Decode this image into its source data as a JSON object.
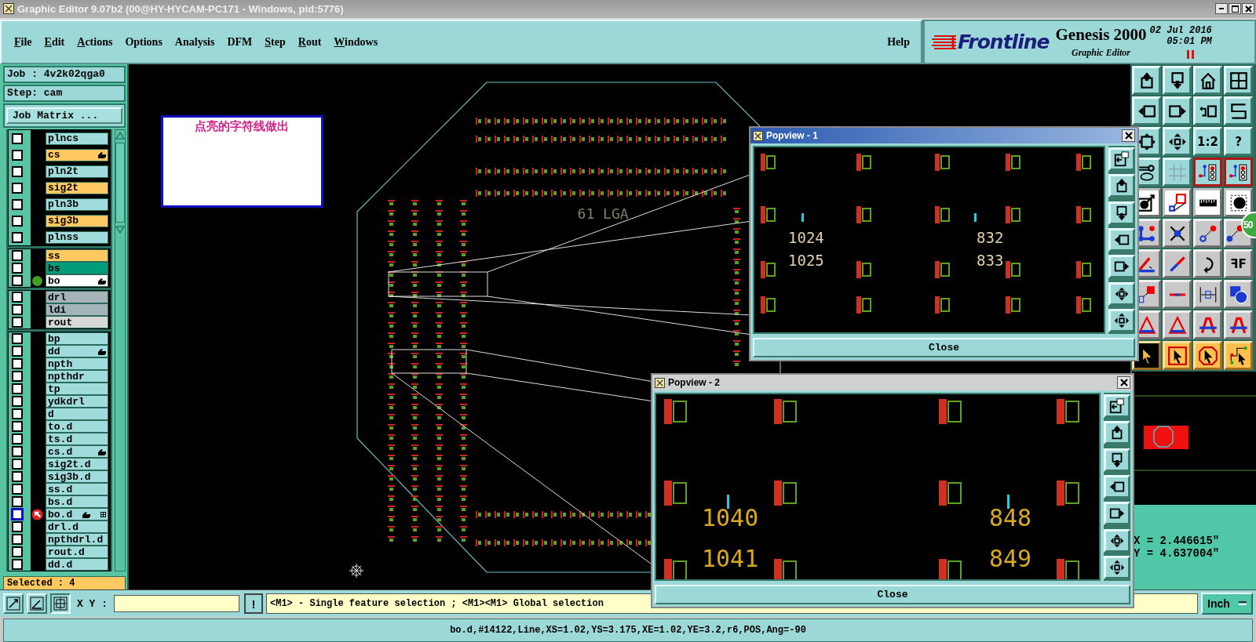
{
  "window": {
    "title": "Graphic Editor 9.07b2 (00@HY-HYCAM-PC171 - Windows, pid:5776)"
  },
  "menu": [
    {
      "label": "File",
      "mnemonic": true
    },
    {
      "label": "Edit",
      "mnemonic": true
    },
    {
      "label": "Actions",
      "mnemonic": true
    },
    {
      "label": "Options",
      "mnemonic": false
    },
    {
      "label": "Analysis",
      "mnemonic": false
    },
    {
      "label": "DFM",
      "mnemonic": false
    },
    {
      "label": "Step",
      "mnemonic": true
    },
    {
      "label": "Rout",
      "mnemonic": true
    },
    {
      "label": "Windows",
      "mnemonic": true
    }
  ],
  "help": "Help",
  "brand": {
    "logo": "Frontline",
    "product": "Genesis 2000",
    "subtitle": "Graphic Editor",
    "date": "02 Jul 2016",
    "time": "05:01 PM"
  },
  "job": "Job : 4v2k02qga0",
  "step": "Step: cam",
  "job_matrix": "Job Matrix ...",
  "layer_groups": [
    {
      "kind": "board",
      "layers": [
        {
          "name": "plncs",
          "color": "#a0dcdc",
          "checked": false,
          "hand": false,
          "dot": false,
          "work": false
        },
        {
          "name": "cs",
          "color": "#ffc860",
          "checked": false,
          "hand": true,
          "dot": false,
          "work": false
        },
        {
          "name": "pln2t",
          "color": "#a0dcdc",
          "checked": false,
          "hand": false,
          "dot": false,
          "work": false
        },
        {
          "name": "sig2t",
          "color": "#ffc860",
          "checked": false,
          "hand": false,
          "dot": false,
          "work": false
        },
        {
          "name": "pln3b",
          "color": "#a0dcdc",
          "checked": false,
          "hand": false,
          "dot": false,
          "work": false
        },
        {
          "name": "sig3b",
          "color": "#ffc860",
          "checked": false,
          "hand": false,
          "dot": false,
          "work": false
        },
        {
          "name": "plnss",
          "color": "#a0dcdc",
          "checked": false,
          "hand": false,
          "dot": false,
          "work": false
        }
      ]
    },
    {
      "kind": "misc",
      "layers": [
        {
          "name": "ss",
          "color": "#ffc860",
          "checked": false,
          "hand": false,
          "dot": false,
          "work": false
        },
        {
          "name": "bs",
          "color": "#009c78",
          "checked": false,
          "hand": false,
          "dot": false,
          "work": false
        },
        {
          "name": "bo",
          "color": "#ffffff",
          "checked": false,
          "hand": true,
          "dot": true,
          "work": false
        }
      ]
    },
    {
      "kind": "misc",
      "layers": [
        {
          "name": "drl",
          "color": "#a4b4b8",
          "checked": false,
          "hand": false,
          "dot": false,
          "work": false
        },
        {
          "name": "ldi",
          "color": "#a4b4b8",
          "checked": false,
          "hand": false,
          "dot": false,
          "work": false
        },
        {
          "name": "rout",
          "color": "#d8d8d8",
          "checked": false,
          "hand": false,
          "dot": false,
          "work": false
        }
      ]
    },
    {
      "kind": "misc",
      "layers": [
        {
          "name": "bp",
          "color": "#a0dcdc",
          "checked": false,
          "hand": false,
          "dot": false,
          "work": false
        },
        {
          "name": "dd",
          "color": "#a0dcdc",
          "checked": false,
          "hand": true,
          "dot": false,
          "work": false
        },
        {
          "name": "npth",
          "color": "#a0dcdc",
          "checked": false,
          "hand": false,
          "dot": false,
          "work": false
        },
        {
          "name": "npthdr",
          "color": "#a0dcdc",
          "checked": false,
          "hand": false,
          "dot": false,
          "work": false
        },
        {
          "name": "tp",
          "color": "#a0dcdc",
          "checked": false,
          "hand": false,
          "dot": false,
          "work": false
        },
        {
          "name": "ydkdrl",
          "color": "#a0dcdc",
          "checked": false,
          "hand": false,
          "dot": false,
          "work": false
        },
        {
          "name": "d",
          "color": "#a0dcdc",
          "checked": false,
          "hand": false,
          "dot": false,
          "work": false
        },
        {
          "name": "to.d",
          "color": "#a0dcdc",
          "checked": false,
          "hand": false,
          "dot": false,
          "work": false
        },
        {
          "name": "ts.d",
          "color": "#a0dcdc",
          "checked": false,
          "hand": false,
          "dot": false,
          "work": false
        },
        {
          "name": "cs.d",
          "color": "#a0dcdc",
          "checked": false,
          "hand": true,
          "dot": false,
          "work": false
        },
        {
          "name": "sig2t.d",
          "color": "#a0dcdc",
          "checked": false,
          "hand": false,
          "dot": false,
          "work": false
        },
        {
          "name": "sig3b.d",
          "color": "#a0dcdc",
          "checked": false,
          "hand": false,
          "dot": false,
          "work": false
        },
        {
          "name": "ss.d",
          "color": "#a0dcdc",
          "checked": false,
          "hand": false,
          "dot": false,
          "work": false
        },
        {
          "name": "bs.d",
          "color": "#a0dcdc",
          "checked": false,
          "hand": false,
          "dot": false,
          "work": false
        },
        {
          "name": "bo.d",
          "color": "#a0dcdc",
          "checked": false,
          "hand": true,
          "dot": false,
          "work": true
        },
        {
          "name": "drl.d",
          "color": "#a0dcdc",
          "checked": false,
          "hand": false,
          "dot": false,
          "work": false
        },
        {
          "name": "npthdrl.d",
          "color": "#a0dcdc",
          "checked": false,
          "hand": false,
          "dot": false,
          "work": false
        },
        {
          "name": "rout.d",
          "color": "#a0dcdc",
          "checked": false,
          "hand": false,
          "dot": false,
          "work": false
        },
        {
          "name": "dd.d",
          "color": "#a0dcdc",
          "checked": false,
          "hand": false,
          "dot": false,
          "work": false
        }
      ]
    }
  ],
  "selected_count": "Selected : 4",
  "note": "点亮的字符线做出",
  "board_label": "61 LGA",
  "toolbar": [
    {
      "kind": "view",
      "tools": [
        {
          "kind": "up",
          "on": false
        },
        {
          "kind": "down",
          "on": false
        },
        {
          "kind": "home",
          "on": false
        },
        {
          "kind": "grid-xy",
          "on": false
        }
      ]
    },
    {
      "kind": "view",
      "tools": [
        {
          "kind": "left",
          "on": false
        },
        {
          "kind": "right",
          "on": false
        },
        {
          "kind": "undo",
          "on": false
        },
        {
          "kind": "s-curve",
          "on": false
        }
      ]
    },
    {
      "kind": "view",
      "tools": [
        {
          "kind": "fit",
          "on": false
        },
        {
          "kind": "pan",
          "on": false
        },
        {
          "kind": "text",
          "label": "1:2",
          "on": false
        },
        {
          "kind": "text",
          "label": "?",
          "on": false
        }
      ]
    },
    {
      "kind": "view",
      "tools": [
        {
          "kind": "wrench",
          "on": false
        },
        {
          "kind": "grid",
          "on": false
        },
        {
          "kind": "circuit",
          "on": true
        },
        {
          "kind": "circuit",
          "on": true
        }
      ]
    },
    {
      "kind": "snap",
      "tools": [
        {
          "kind": "dot-arrow",
          "on": false
        },
        {
          "kind": "squares",
          "on": false
        },
        {
          "kind": "ruler",
          "on": false
        },
        {
          "kind": "circle",
          "on": false
        }
      ]
    },
    {
      "kind": "edit",
      "tools": [
        {
          "kind": "dots",
          "on": false
        },
        {
          "kind": "cross",
          "on": false
        },
        {
          "kind": "dot-line-open",
          "on": false
        },
        {
          "kind": "dot-line",
          "on": false
        }
      ]
    },
    {
      "kind": "edit",
      "tools": [
        {
          "kind": "angle",
          "on": false
        },
        {
          "kind": "diagonal",
          "on": false
        },
        {
          "kind": "rotate",
          "on": false
        },
        {
          "kind": "text",
          "label": "ꟻF",
          "on": false
        }
      ]
    },
    {
      "kind": "edit",
      "tools": [
        {
          "kind": "square-arrow",
          "on": false
        },
        {
          "kind": "line",
          "on": false
        },
        {
          "kind": "measure",
          "on": false
        },
        {
          "kind": "shapes",
          "on": false
        }
      ]
    },
    {
      "kind": "edit",
      "tools": [
        {
          "kind": "triangle",
          "on": false
        },
        {
          "kind": "triangle",
          "on": false
        },
        {
          "kind": "arch",
          "on": false
        },
        {
          "kind": "arch",
          "on": false
        }
      ]
    },
    {
      "kind": "select",
      "tools": [
        {
          "kind": "pointer",
          "on": true
        },
        {
          "kind": "pointer-box",
          "on": false
        },
        {
          "kind": "pointer-octagon",
          "on": false
        },
        {
          "kind": "pointer-route",
          "on": false
        }
      ]
    }
  ],
  "badge": "50",
  "coordinates": [
    "X = 2.446615\"",
    "Y = 4.637004\""
  ],
  "popviews": [
    {
      "title": "Popview - 1",
      "active": true,
      "labels": [
        "1024",
        "1025",
        "832",
        "833"
      ],
      "close": "Close",
      "tools": [
        {
          "kind": "window-arrow"
        },
        {
          "kind": "up"
        },
        {
          "kind": "down"
        },
        {
          "kind": "left"
        },
        {
          "kind": "right"
        },
        {
          "kind": "fit-in"
        },
        {
          "kind": "pan"
        }
      ]
    },
    {
      "title": "Popview - 2",
      "active": false,
      "labels": [
        "1040",
        "1041",
        "848",
        "849"
      ],
      "close": "Close",
      "tools": [
        {
          "kind": "window-arrow"
        },
        {
          "kind": "up"
        },
        {
          "kind": "down"
        },
        {
          "kind": "left"
        },
        {
          "kind": "right"
        },
        {
          "kind": "fit-in"
        },
        {
          "kind": "pan"
        }
      ]
    }
  ],
  "bottom": {
    "xy_label": "X Y :",
    "alert": "!",
    "message": "<M1> - Single feature selection ; <M1><M1> Global selection",
    "units": "Inch"
  },
  "status_bar": "bo.d,#14122,Line,XS=1.02,YS=3.175,XE=1.02,YE=3.2,r6,POS,Ang=-90"
}
